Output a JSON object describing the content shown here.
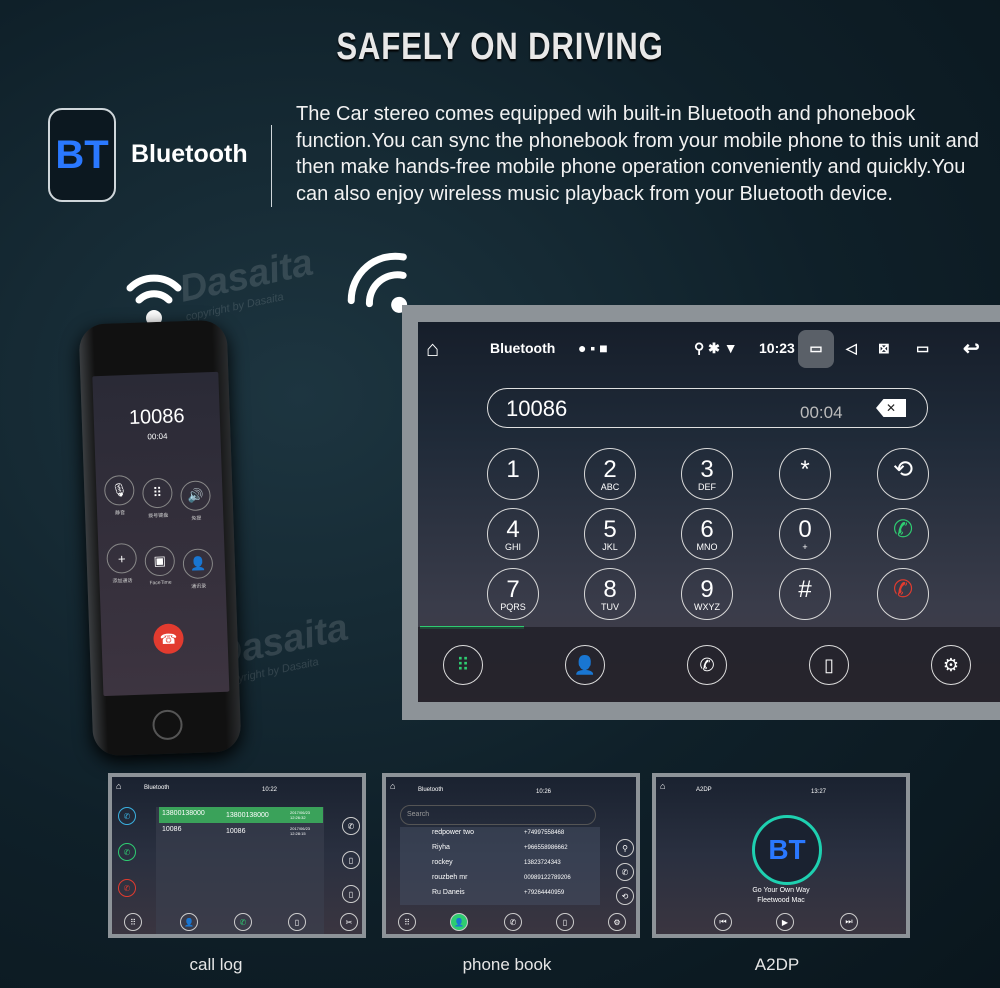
{
  "header": {
    "title": "SAFELY ON DRIVING"
  },
  "feature": {
    "icon_text": "BT",
    "label": "Bluetooth",
    "description": "The Car stereo comes equipped wih built-in Bluetooth and phonebook function.You can sync the phonebook from your mobile phone to this unit and then make hands-free mobile phone operation conveniently and quickly.You can also enjoy wireless music playback from your Bluetooth device.",
    "accent": "#2a78ff"
  },
  "watermark": {
    "brand": "Dasaita",
    "sub": "copyright by Dasaita"
  },
  "phone": {
    "number": "10086",
    "duration": "00:04",
    "buttons": [
      "静音",
      "拨号键盘",
      "免提",
      "添加通话",
      "FaceTime",
      "通讯录"
    ]
  },
  "head_unit": {
    "status": {
      "app": "Bluetooth",
      "time": "10:23"
    },
    "dial": {
      "number": "10086",
      "timer": "00:04"
    },
    "keys": [
      {
        "d": "1",
        "l": ""
      },
      {
        "d": "2",
        "l": "ABC"
      },
      {
        "d": "3",
        "l": "DEF"
      },
      {
        "d": "*",
        "l": ""
      },
      {
        "d": "⟲",
        "l": ""
      },
      {
        "d": "4",
        "l": "GHI"
      },
      {
        "d": "5",
        "l": "JKL"
      },
      {
        "d": "6",
        "l": "MNO"
      },
      {
        "d": "0",
        "l": "+"
      },
      {
        "d": "✆",
        "l": ""
      },
      {
        "d": "7",
        "l": "PQRS"
      },
      {
        "d": "8",
        "l": "TUV"
      },
      {
        "d": "9",
        "l": "WXYZ"
      },
      {
        "d": "#",
        "l": ""
      },
      {
        "d": "✆",
        "l": ""
      }
    ],
    "accent_green": "#2ecc71",
    "end_red": "#e23b2f"
  },
  "thumbnails": [
    {
      "caption": "call log",
      "app": "Bluetooth",
      "time": "10:22",
      "rows": [
        [
          "13800138000",
          "13800138000",
          "2017/06/23 12:26:32"
        ],
        [
          "10086",
          "10086",
          "2017/06/23 12:28:15"
        ]
      ]
    },
    {
      "caption": "phone book",
      "app": "Bluetooth",
      "time": "10:26",
      "search": "Search",
      "rows": [
        [
          "redpower two",
          "+74997558468"
        ],
        [
          "Riyha",
          "+966558986662"
        ],
        [
          "rockey",
          "13823724343"
        ],
        [
          "rouzbeh mr",
          "00989122789206"
        ],
        [
          "Ru Daneis",
          "+79264440959"
        ]
      ]
    },
    {
      "caption": "A2DP",
      "app": "A2DP",
      "time": "13:27",
      "logo": "BT",
      "song": "Go Your Own Way",
      "artist": "Fleetwood Mac"
    }
  ]
}
